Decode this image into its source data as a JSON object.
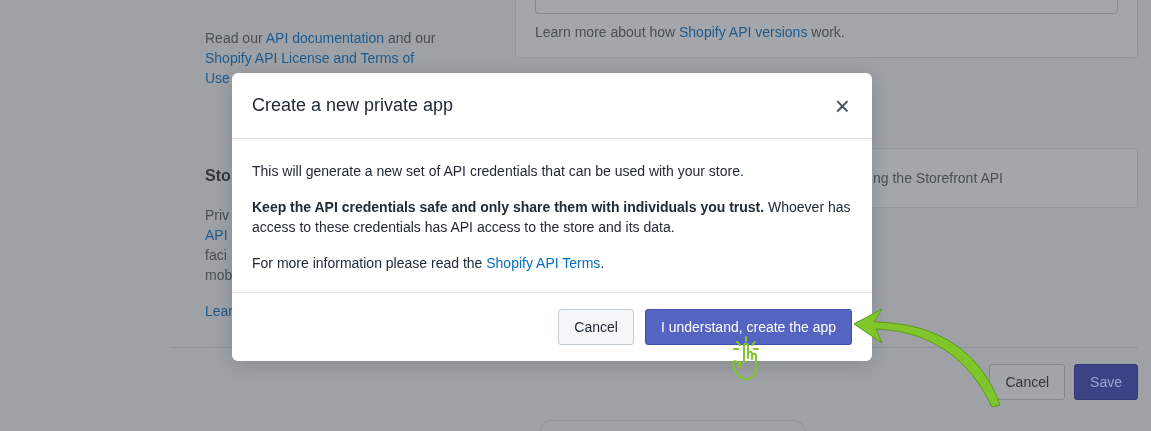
{
  "background": {
    "api_intro": [
      [
        {
          "kind": "text",
          "text": "Read our "
        },
        {
          "kind": "link",
          "text": "API documentation"
        },
        {
          "kind": "text",
          "text": " and our"
        }
      ],
      [
        {
          "kind": "link",
          "text": "Shopify API License and Terms of"
        }
      ],
      [
        {
          "kind": "link",
          "text": "Use"
        }
      ]
    ],
    "version_help": [
      {
        "kind": "text",
        "text": "Learn more about how "
      },
      {
        "kind": "link",
        "text": "Shopify API versions"
      },
      {
        "kind": "text",
        "text": " work."
      }
    ],
    "storefront_heading": "Sto",
    "storefront_lines": [
      {
        "kind": "text",
        "text": "Priv"
      },
      {
        "kind": "link",
        "text": "API"
      },
      {
        "kind": "text",
        "text": "faci"
      },
      {
        "kind": "text",
        "text": "mob"
      }
    ],
    "storefront_link": "Lear",
    "storefront_card_text": "ng the Storefront API",
    "buttons": [
      {
        "label": "Cancel",
        "kind": "secondary"
      },
      {
        "label": "Save",
        "kind": "primary"
      }
    ]
  },
  "modal": {
    "title": "Create a new private app",
    "close": "×",
    "paragraphs": [
      [
        {
          "kind": "text",
          "text": "This will generate a new set of API credentials that can be used with your store."
        }
      ],
      [
        {
          "kind": "rich",
          "text": "**Keep the API credentials safe and only share them with individuals you trust.** Whoever has access to these credentials has API access to the store and its data."
        }
      ],
      [
        {
          "kind": "text",
          "text": "For more information please read the "
        },
        {
          "kind": "link",
          "text": "Shopify API Terms"
        },
        {
          "kind": "text",
          "text": "."
        }
      ]
    ],
    "buttons": [
      {
        "label": "Cancel",
        "kind": "secondary"
      },
      {
        "label": "I understand, create the app",
        "kind": "primary"
      }
    ]
  }
}
